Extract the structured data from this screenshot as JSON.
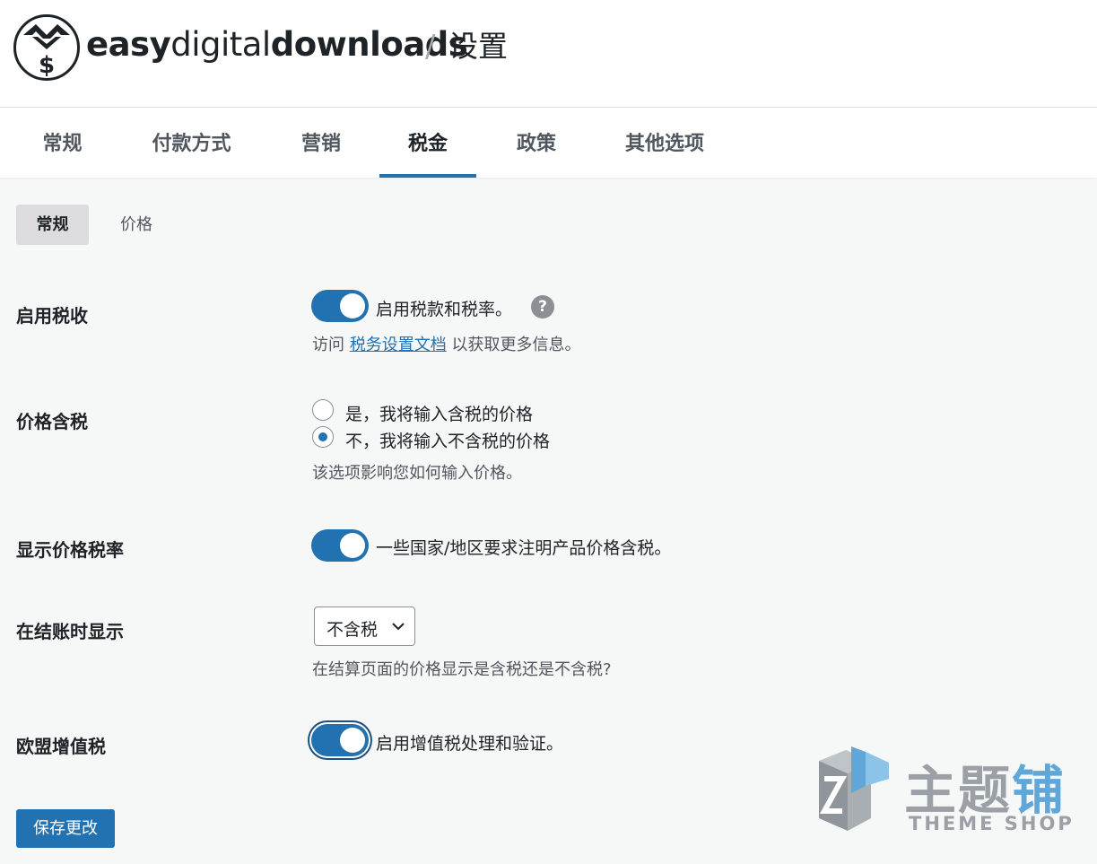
{
  "header": {
    "brand_bold_1": "easy",
    "brand_light": "digital",
    "brand_bold_2": "downloads",
    "separator": "/",
    "page_title": "设置",
    "logo_icon": "easy-digital-downloads-logo"
  },
  "tabs": [
    {
      "label": "常规",
      "active": false
    },
    {
      "label": "付款方式",
      "active": false
    },
    {
      "label": "营销",
      "active": false
    },
    {
      "label": "税金",
      "active": true
    },
    {
      "label": "政策",
      "active": false
    },
    {
      "label": "其他选项",
      "active": false
    }
  ],
  "subtabs": [
    {
      "label": "常规",
      "active": true
    },
    {
      "label": "价格",
      "active": false
    }
  ],
  "settings": {
    "enable_tax": {
      "label": "启用税收",
      "enabled": true,
      "toggle_text": "启用税款和税率。",
      "help_icon": "?",
      "desc_prefix": "访问",
      "desc_link": "税务设置文档",
      "desc_suffix": "以获取更多信息。"
    },
    "prices_include_tax": {
      "label": "价格含税",
      "options": [
        {
          "label": "是，我将输入含税的价格",
          "checked": false
        },
        {
          "label": "不，我将输入不含税的价格",
          "checked": true
        }
      ],
      "desc": "该选项影响您如何输入价格。"
    },
    "display_tax_rate": {
      "label": "显示价格税率",
      "enabled": true,
      "toggle_text": "一些国家/地区要求注明产品价格含税。"
    },
    "checkout_display": {
      "label": "在结账时显示",
      "selected": "不含税",
      "desc": "在结算页面的价格显示是含税还是不含税?"
    },
    "eu_vat": {
      "label": "欧盟增值税",
      "enabled": true,
      "toggle_text": "启用增值税处理和验证。"
    }
  },
  "save_button": "保存更改",
  "watermark": {
    "cn_main": "主题",
    "cn_accent": "铺",
    "en": "THEME SHOP"
  },
  "colors": {
    "accent": "#2271b1",
    "background": "#f6f7f7",
    "text": "#1d2327",
    "muted": "#50575e"
  }
}
